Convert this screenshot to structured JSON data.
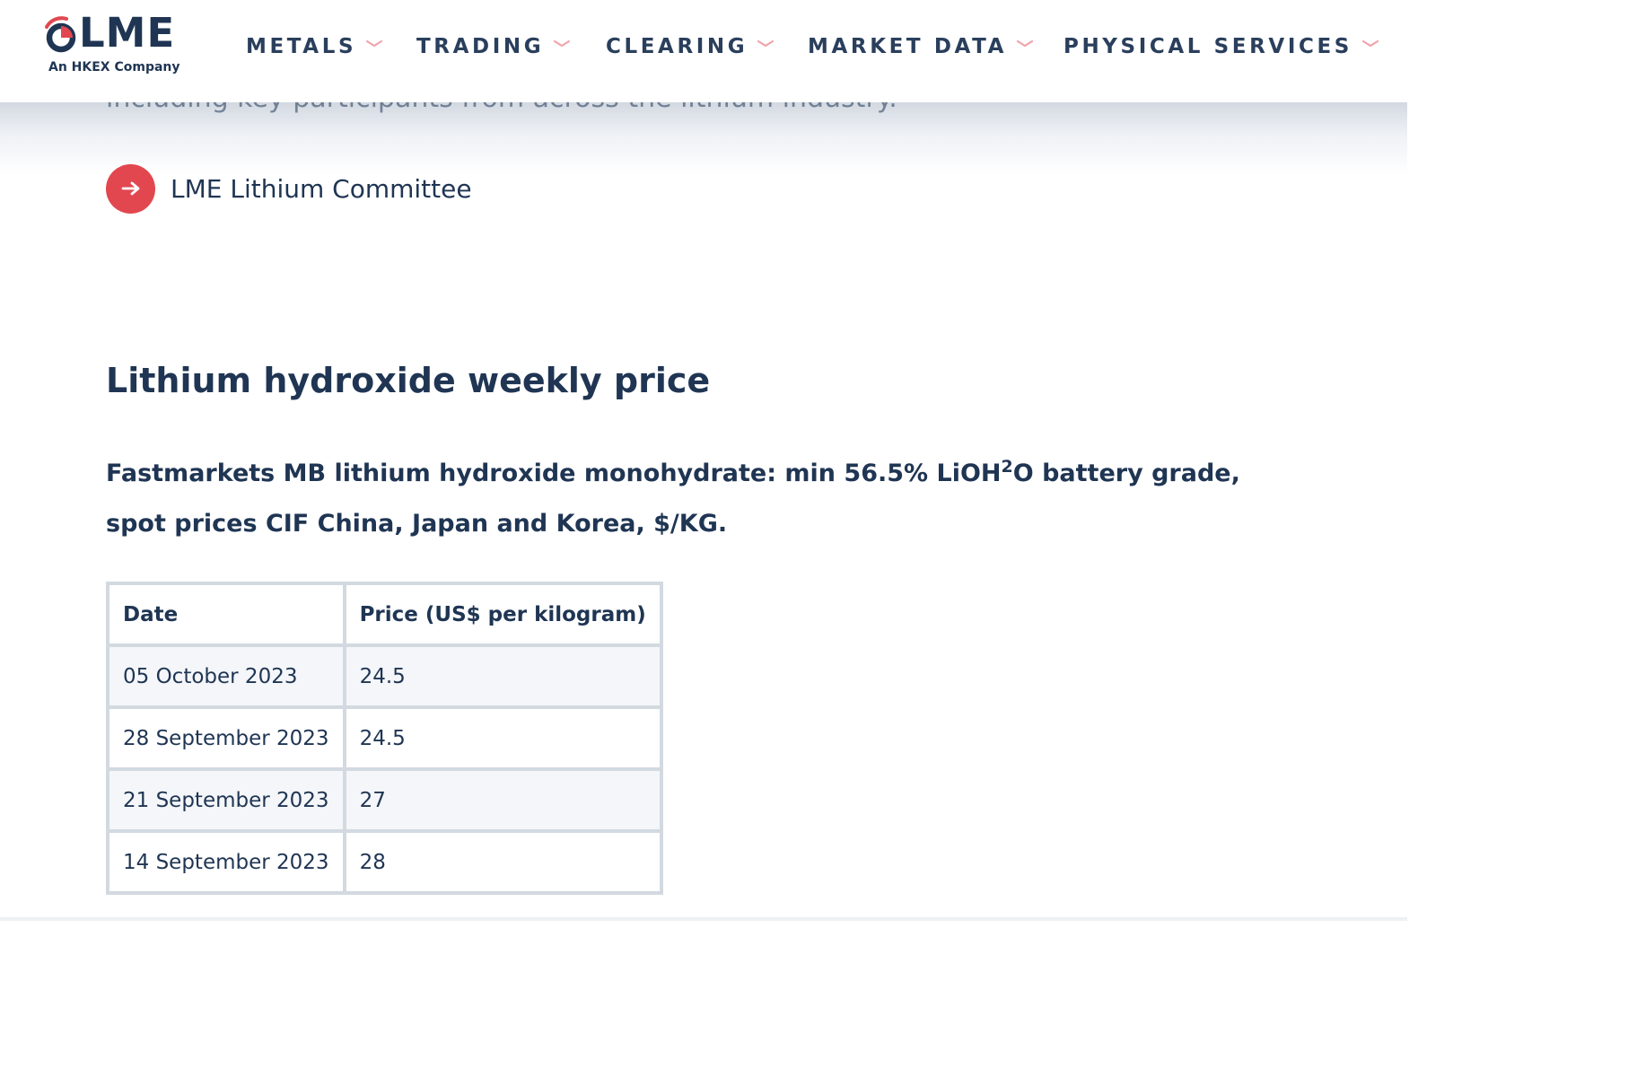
{
  "brand": {
    "logo_text": "LME",
    "logo_subtitle": "An HKEX Company",
    "colors": {
      "navy": "#1f3553",
      "accent_red": "#e2474f",
      "chevron_pink": "#f0a3a9",
      "table_border": "#d3d9e0",
      "row_shade": "#f4f6f9"
    }
  },
  "nav": {
    "items": [
      {
        "label": "METALS",
        "icon": "chevron-down-icon"
      },
      {
        "label": "TRADING",
        "icon": "chevron-down-icon"
      },
      {
        "label": "CLEARING",
        "icon": "chevron-down-icon"
      },
      {
        "label": "MARKET DATA",
        "icon": "chevron-down-icon"
      },
      {
        "label": "PHYSICAL SERVICES",
        "icon": "chevron-down-icon"
      }
    ]
  },
  "content": {
    "cutoff_text": "including key participants from across the lithium industry.",
    "committee_link": {
      "label": "LME Lithium Committee",
      "icon": "arrow-right-icon"
    },
    "section_title": "Lithium hydroxide weekly price",
    "description": {
      "part1": "Fastmarkets MB lithium hydroxide monohydrate: min 56.5% LiOH",
      "superscript": "2",
      "part2": "O battery grade, spot prices CIF China, Japan and Korea, $/KG."
    },
    "table": {
      "headers": [
        "Date",
        "Price (US$ per kilogram)"
      ],
      "rows": [
        {
          "date": "05 October 2023",
          "price": "24.5"
        },
        {
          "date": "28 September 2023",
          "price": "24.5"
        },
        {
          "date": "21 September 2023",
          "price": "27"
        },
        {
          "date": "14 September 2023",
          "price": "28"
        }
      ]
    }
  }
}
